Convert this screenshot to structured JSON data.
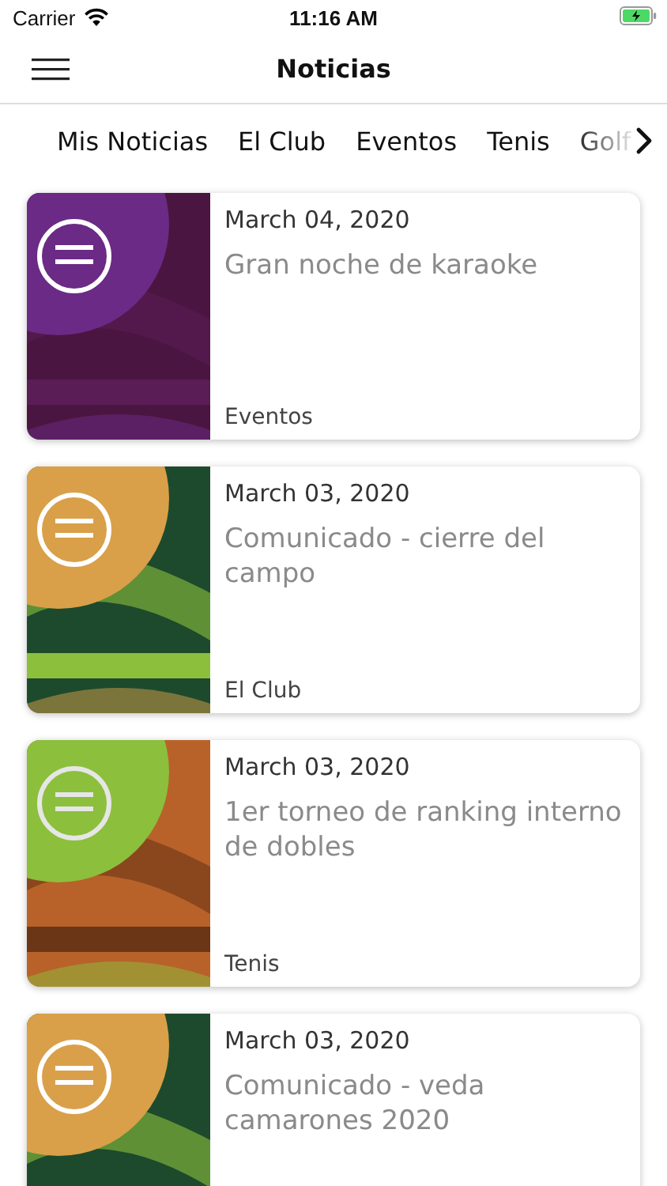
{
  "status_bar": {
    "carrier": "Carrier",
    "time": "11:16 AM"
  },
  "nav_bar": {
    "title": "Noticias"
  },
  "tabs": [
    {
      "label": "Mis Noticias"
    },
    {
      "label": "El Club"
    },
    {
      "label": "Eventos"
    },
    {
      "label": "Tenis"
    },
    {
      "label": "Golf"
    }
  ],
  "news": [
    {
      "date": "March 04, 2020",
      "title": "Gran noche de karaoke",
      "category": "Eventos"
    },
    {
      "date": "March 03, 2020",
      "title": "Comunicado - cierre del campo",
      "category": "El Club"
    },
    {
      "date": "March 03, 2020",
      "title": "1er torneo de ranking interno de dobles",
      "category": "Tenis"
    },
    {
      "date": "March 03, 2020",
      "title": "Comunicado - veda camarones 2020"
    }
  ]
}
